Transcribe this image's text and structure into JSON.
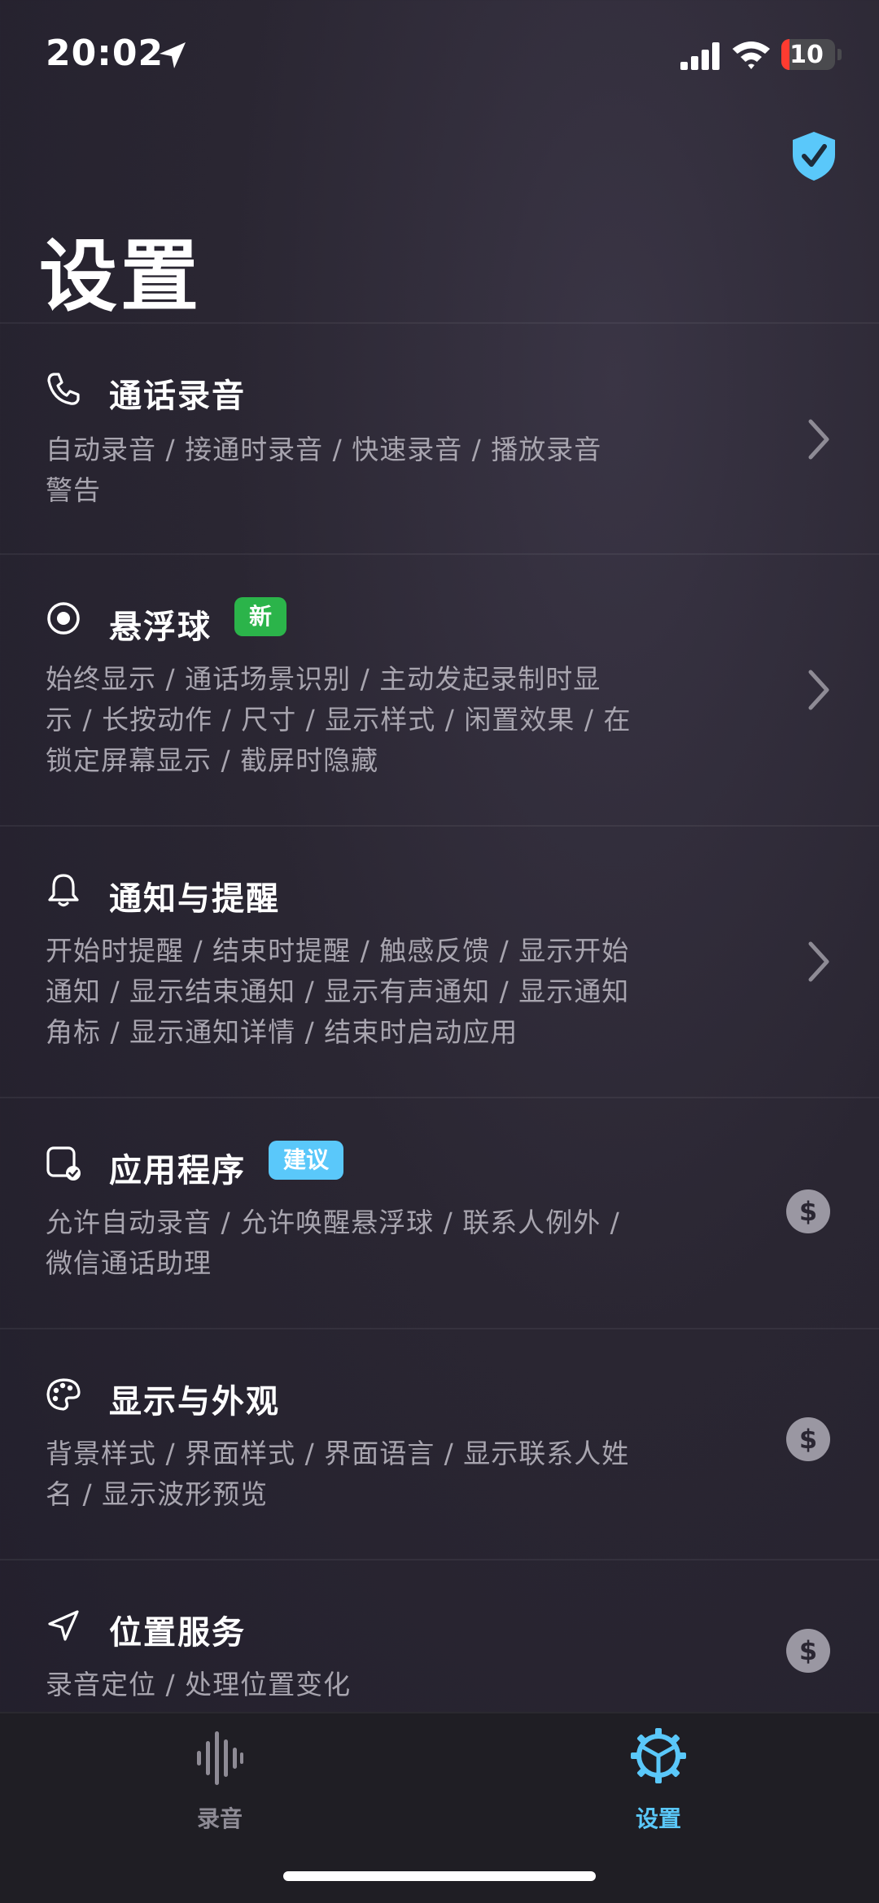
{
  "status": {
    "time": "20:02",
    "battery": "10"
  },
  "page_title": "设置",
  "colors": {
    "accent": "#5ac8fa",
    "new_badge": "#2bb44a",
    "suggest_badge": "#5ac8fa"
  },
  "sections": [
    {
      "title": "通话录音",
      "icon": "phone-icon",
      "subtitle": [
        "自动录音 / 接通时录音 / 快速录音 / 播放录音",
        "警告"
      ],
      "trailing": "chevron"
    },
    {
      "title": "悬浮球",
      "icon": "record-dot-icon",
      "badge": "新",
      "subtitle": [
        "始终显示 / 通话场景识别 / 主动发起录制时显",
        "示 / 长按动作 / 尺寸 / 显示样式 / 闲置效果 / 在",
        "锁定屏幕显示 / 截屏时隐藏"
      ],
      "trailing": "chevron"
    },
    {
      "title": "通知与提醒",
      "icon": "bell-icon",
      "subtitle": [
        "开始时提醒 / 结束时提醒 / 触感反馈 / 显示开始",
        "通知 / 显示结束通知 / 显示有声通知 / 显示通知",
        "角标 / 显示通知详情 / 结束时启动应用"
      ],
      "trailing": "chevron"
    },
    {
      "title": "应用程序",
      "icon": "app-check-icon",
      "badge": "建议",
      "subtitle": [
        "允许自动录音 / 允许唤醒悬浮球 / 联系人例外 /",
        "微信通话助理"
      ],
      "trailing": "$"
    },
    {
      "title": "显示与外观",
      "icon": "palette-icon",
      "subtitle": [
        "背景样式 / 界面样式 / 界面语言 / 显示联系人姓",
        "名 / 显示波形预览"
      ],
      "trailing": "$"
    },
    {
      "title": "位置服务",
      "icon": "location-arrow-icon",
      "subtitle": [
        "录音定位 / 处理位置变化"
      ],
      "trailing": "$"
    }
  ],
  "tabs": [
    {
      "label": "录音",
      "icon": "waveform-icon",
      "active": false
    },
    {
      "label": "设置",
      "icon": "gear-icon",
      "active": true
    }
  ]
}
